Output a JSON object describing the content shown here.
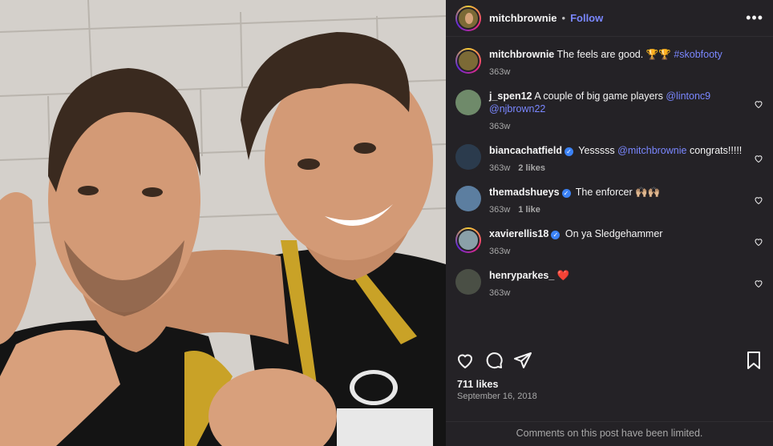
{
  "post": {
    "username": "mitchbrownie",
    "follow_label": "Follow",
    "separator": "•",
    "more_label": "•••"
  },
  "caption": {
    "username": "mitchbrownie",
    "text": "The feels are good. 🏆🏆",
    "hashtag": "#skobfooty",
    "time": "363w"
  },
  "comments": [
    {
      "username": "j_spen12",
      "text": "A couple of big game players",
      "mentions": [
        "@lintonc9",
        "@njbrown22"
      ],
      "time": "363w",
      "likes": ""
    },
    {
      "username": "biancachatfield",
      "verified": true,
      "text_pre": "Yesssss",
      "mention": "@mitchbrownie",
      "text_post": "congrats!!!!!",
      "time": "363w",
      "likes": "2 likes"
    },
    {
      "username": "themadshueys",
      "verified": true,
      "text": "The enforcer 🙌🏼🙌🏼",
      "time": "363w",
      "likes": "1 like"
    },
    {
      "username": "xavierellis18",
      "verified": true,
      "text": "On ya Sledgehammer",
      "time": "363w",
      "likes": ""
    },
    {
      "username": "henryparkes_",
      "text": "❤️",
      "time": "363w",
      "likes": ""
    }
  ],
  "footer": {
    "likes": "711 likes",
    "date": "September 16, 2018",
    "limited_notice": "Comments on this post have been limited."
  },
  "icons": [
    "heart-icon",
    "comment-icon",
    "share-icon",
    "bookmark-icon",
    "more-icon",
    "verified-icon"
  ],
  "colors": {
    "panel_bg": "#242226",
    "link": "#7a87ff",
    "verified": "#3b82f6",
    "muted": "#a8a8a8"
  }
}
